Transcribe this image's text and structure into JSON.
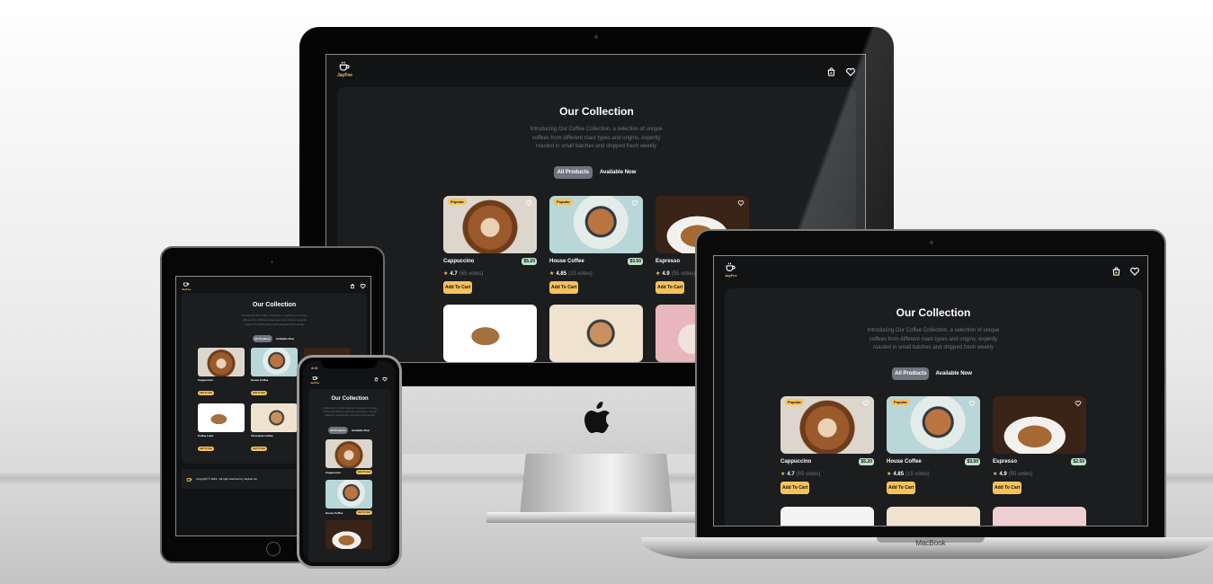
{
  "site": {
    "logo_text": "JayFee",
    "title": "Our Collection",
    "intro": "Introducing Our Coffee Collection, a selection of unique coffees from different roast types and origins, expertly roasted in small batches and shipped fresh weekly",
    "tabs": [
      "All Products",
      "Available Now"
    ],
    "products": [
      {
        "name": "Cappuccino",
        "price": "$5.20",
        "rating": "4.7",
        "votes": "(65 votes)",
        "badge": "Popular",
        "cta": "Add To Cart"
      },
      {
        "name": "House Coffee",
        "price": "$3.50",
        "rating": "4.85",
        "votes": "(15 votes)",
        "badge": "Popular",
        "cta": "Add To Cart"
      },
      {
        "name": "Espresso",
        "price": "$2.50",
        "rating": "4.9",
        "votes": "(55 votes)",
        "cta": "Add To Cart"
      }
    ],
    "footer": "Copyright © 2024 - All right reserved by JayFee Inc."
  },
  "tablet_products": [
    {
      "name": "Cappuccino",
      "cta": "Add To Cart"
    },
    {
      "name": "House Coffee",
      "cta": "Add To Cart"
    },
    {
      "name": "Espresso",
      "cta": "Add To Cart"
    },
    {
      "name": "Coffee Latte",
      "cta": "Add To Cart"
    },
    {
      "name": "Chocolate Coffee",
      "cta": "Add To Cart"
    }
  ],
  "phone": {
    "time": "4:41"
  },
  "devices": {
    "laptop_label": "MacBook"
  },
  "colors": {
    "accent": "#f6c25c",
    "price_bg": "#bee3cc",
    "bg": "#111315",
    "panel": "#1b1d1f",
    "muted": "#6f757c"
  },
  "icons": [
    "coffee-cup-icon",
    "bag-icon",
    "heart-icon",
    "star-icon",
    "apple-icon"
  ]
}
